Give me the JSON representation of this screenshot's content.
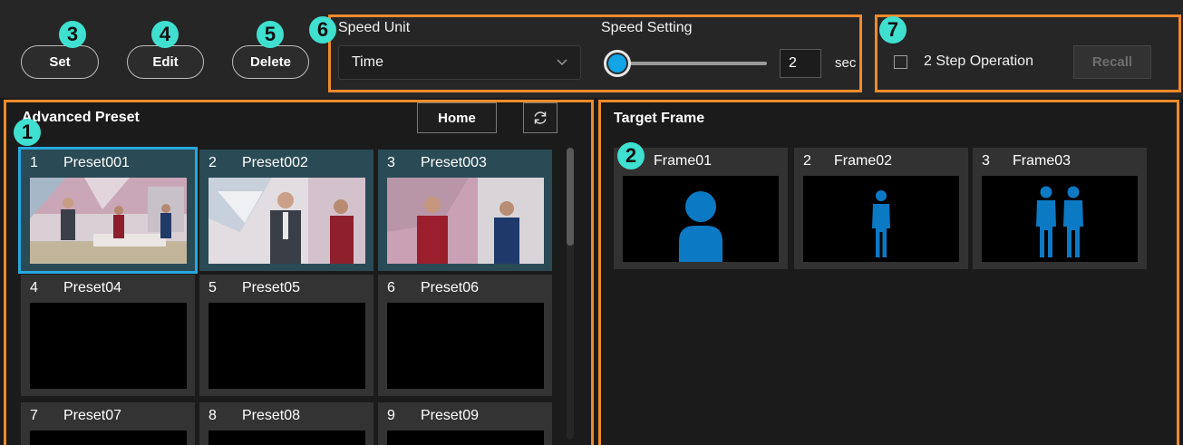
{
  "toolbar": {
    "set_label": "Set",
    "edit_label": "Edit",
    "delete_label": "Delete",
    "speed_unit_label": "Speed Unit",
    "speed_unit_value": "Time",
    "speed_setting_label": "Speed Setting",
    "speed_value": "2",
    "speed_unit_suffix": "sec",
    "slider_level": 0,
    "two_step_label": "2 Step Operation",
    "two_step_checked": false,
    "recall_label": "Recall"
  },
  "callouts": {
    "c1": "1",
    "c2": "2",
    "c3": "3",
    "c4": "4",
    "c5": "5",
    "c6": "6",
    "c7": "7"
  },
  "advanced_preset": {
    "title": "Advanced Preset",
    "home_label": "Home",
    "presets": [
      {
        "num": "1",
        "name": "Preset001"
      },
      {
        "num": "2",
        "name": "Preset002"
      },
      {
        "num": "3",
        "name": "Preset003"
      },
      {
        "num": "4",
        "name": "Preset04"
      },
      {
        "num": "5",
        "name": "Preset05"
      },
      {
        "num": "6",
        "name": "Preset06"
      },
      {
        "num": "7",
        "name": "Preset07"
      },
      {
        "num": "8",
        "name": "Preset08"
      },
      {
        "num": "9",
        "name": "Preset09"
      }
    ]
  },
  "target_frame": {
    "title": "Target Frame",
    "frames": [
      {
        "num": "",
        "name": "Frame01"
      },
      {
        "num": "2",
        "name": "Frame02"
      },
      {
        "num": "3",
        "name": "Frame03"
      }
    ]
  },
  "colors": {
    "accent": "#26a8df",
    "callout_border": "#ef8a2c",
    "badge": "#3fe0d0",
    "person_icon": "#0c79c4"
  }
}
